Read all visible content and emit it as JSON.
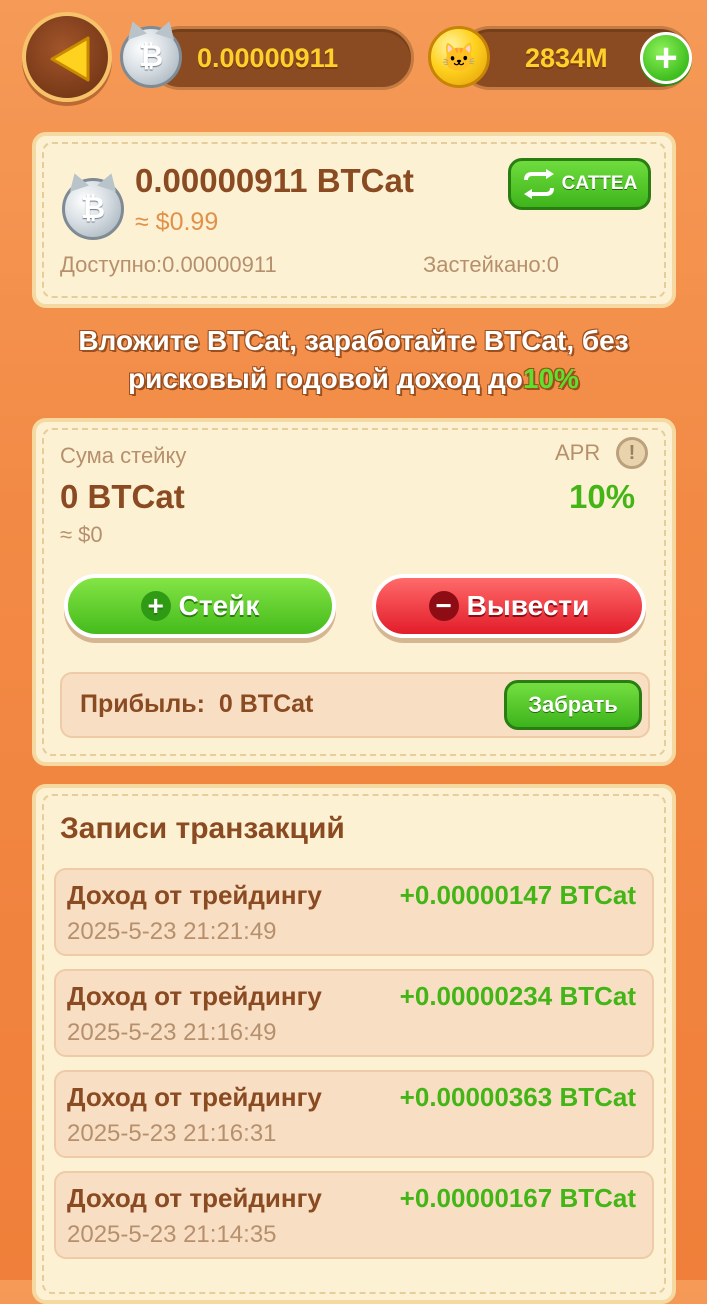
{
  "header": {
    "btc_balance": "0.00000911",
    "coin_balance": "2834M",
    "btc_icon": "btc-cat-coin-icon",
    "gold_icon": "gold-cat-coin-icon"
  },
  "wallet": {
    "amount": "0.00000911 BTCat",
    "usd": "≈ $0.99",
    "swap_label": "CATTEA",
    "available": "Доступно:0.00000911",
    "staked": "Застейкано:0"
  },
  "promo": {
    "text": "Вложите BTCat, заработайте BTCat, без рисковый годовой доход до",
    "highlight": "10%"
  },
  "staking": {
    "label": "Сума стейку",
    "amount": "0 BTCat",
    "usd": "≈ $0",
    "apr_label": "APR",
    "apr_value": "10%",
    "stake_button": "Стейк",
    "withdraw_button": "Вывести",
    "profit_label": "Прибыль:",
    "profit_value": "0 BTCat",
    "collect_button": "Забрать"
  },
  "transactions": {
    "title": "Записи транзакций",
    "items": [
      {
        "title": "Доход от трейдингу",
        "amount": "+0.00000147 BTCat",
        "date": "2025-5-23 21:21:49"
      },
      {
        "title": "Доход от трейдингу",
        "amount": "+0.00000234 BTCat",
        "date": "2025-5-23 21:16:49"
      },
      {
        "title": "Доход от трейдингу",
        "amount": "+0.00000363 BTCat",
        "date": "2025-5-23 21:16:31"
      },
      {
        "title": "Доход от трейдингу",
        "amount": "+0.00000167 BTCat",
        "date": "2025-5-23 21:14:35"
      }
    ]
  },
  "colors": {
    "background": "#f28a45",
    "card": "#fdf1d3",
    "accent_green": "#43b517",
    "accent_red": "#e21d2a",
    "text_brown": "#8a4a22"
  }
}
